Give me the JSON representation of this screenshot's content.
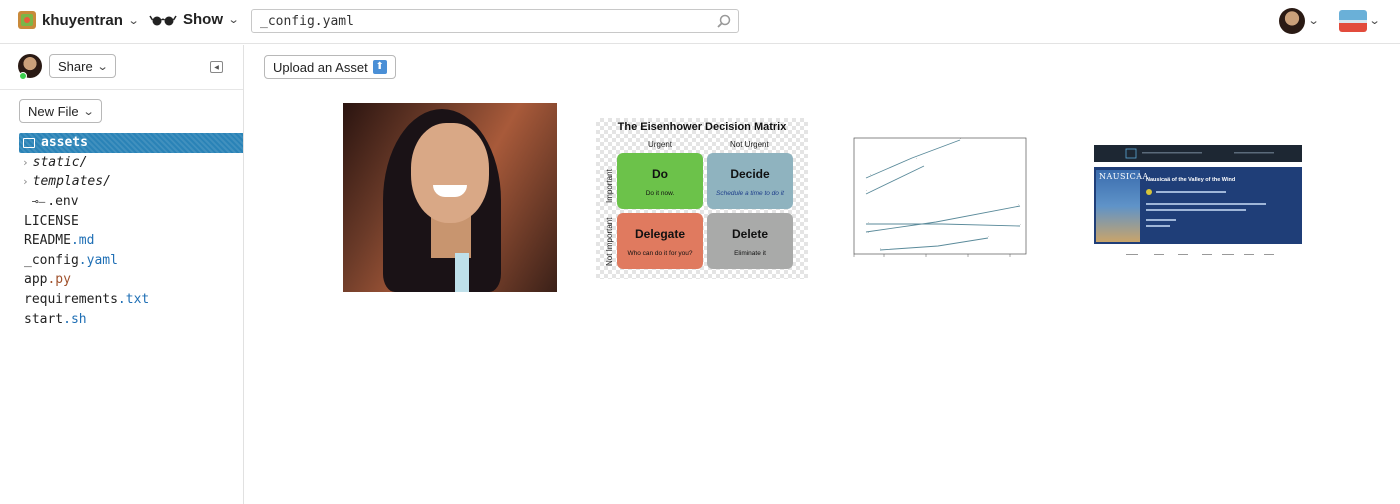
{
  "topbar": {
    "project_name": "khuyentran",
    "show_label": "Show",
    "search_value": "_config.yaml"
  },
  "sidebar": {
    "share_label": "Share",
    "new_file_label": "New File",
    "tree": [
      {
        "name": "assets",
        "kind": "folder-selected"
      },
      {
        "name": "static/",
        "kind": "folder"
      },
      {
        "name": "templates/",
        "kind": "folder"
      },
      {
        "base": "",
        "ext": ".env",
        "kind": "env"
      },
      {
        "base": "LICENSE",
        "ext": "",
        "kind": "file"
      },
      {
        "base": "README",
        "ext": ".md",
        "kind": "file"
      },
      {
        "base": "_config",
        "ext": ".yaml",
        "kind": "file"
      },
      {
        "base": "app",
        "ext": ".py",
        "kind": "file"
      },
      {
        "base": "requirements",
        "ext": ".txt",
        "kind": "file"
      },
      {
        "base": "start",
        "ext": ".sh",
        "kind": "file"
      }
    ]
  },
  "main": {
    "upload_label": "Upload an Asset",
    "eisenhower": {
      "title": "The Eisenhower Decision Matrix",
      "col_urgent": "Urgent",
      "col_not_urgent": "Not Urgent",
      "row_important": "Important",
      "row_not_important": "Not Important",
      "do_title": "Do",
      "do_sub": "Do it now.",
      "decide_title": "Decide",
      "decide_sub": "Schedule a time to do it",
      "delegate_title": "Delegate",
      "delegate_sub": "Who can do it for you?",
      "delete_title": "Delete",
      "delete_sub": "Eliminate it",
      "colors": {
        "do": "#6cc24a",
        "decide": "#8fb3bf",
        "delegate": "#e07a5f",
        "delete": "#a9aaa9"
      }
    },
    "movie": {
      "poster_text": "NAUSICAA",
      "title": "Nausicaä of the Valley of the Wind"
    }
  },
  "colors": {
    "selected": "#2a83b7",
    "accent_ext": "#1f6fb5"
  }
}
